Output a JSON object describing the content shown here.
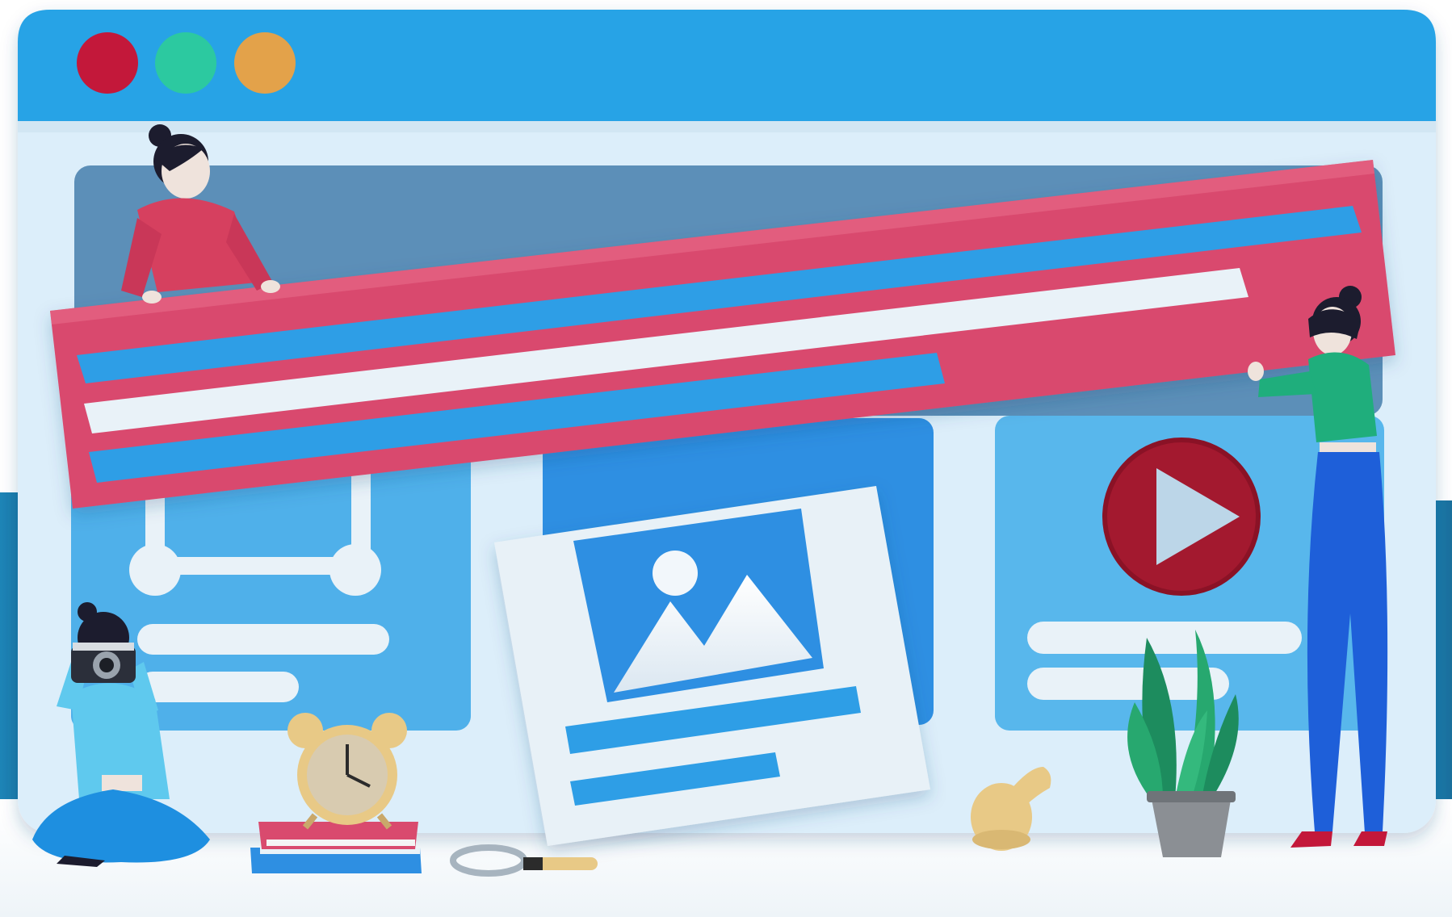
{
  "window": {
    "controls": [
      {
        "name": "close",
        "color": "#c3183a"
      },
      {
        "name": "minimize",
        "color": "#2cc9a0"
      },
      {
        "name": "maximize",
        "color": "#e3a24a"
      }
    ],
    "titlebar_color": "#27a3e6",
    "body_color": "#dceefa"
  },
  "colors": {
    "banner": "#d94a6e",
    "accent_blue": "#2e9ee6",
    "panel_blue": "#4fb0ea",
    "light_bar": "#e9f2f8",
    "play_red": "#a3192f",
    "figure_red": "#d6405f",
    "figure_green": "#1fae7c",
    "figure_cyan": "#5fc9ee",
    "pants_blue": "#1e5fd9"
  },
  "icons": [
    "image-placeholder-icon",
    "play-icon",
    "slider-icon",
    "alarm-clock-icon",
    "camera-icon",
    "plant-icon",
    "magnifier-icon",
    "books-icon"
  ]
}
